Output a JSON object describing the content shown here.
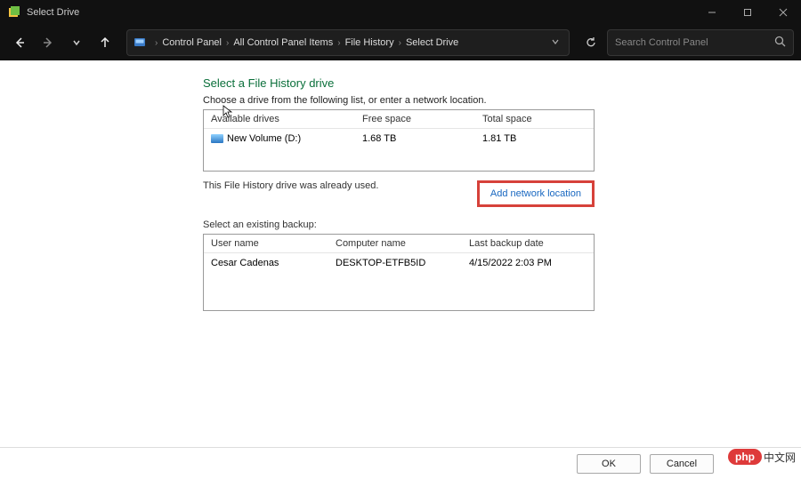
{
  "window": {
    "title": "Select Drive"
  },
  "breadcrumb": {
    "items": [
      "Control Panel",
      "All Control Panel Items",
      "File History",
      "Select Drive"
    ]
  },
  "search": {
    "placeholder": "Search Control Panel"
  },
  "page": {
    "title": "Select a File History drive",
    "description": "Choose a drive from the following list, or enter a network location."
  },
  "drives": {
    "headers": {
      "name": "Available drives",
      "free": "Free space",
      "total": "Total space"
    },
    "rows": [
      {
        "name": "New Volume (D:)",
        "free": "1.68 TB",
        "total": "1.81 TB"
      }
    ]
  },
  "status": {
    "already_used": "This File History drive was already used.",
    "add_network_link": "Add network location"
  },
  "backups": {
    "heading": "Select an existing backup:",
    "headers": {
      "user": "User name",
      "computer": "Computer name",
      "last": "Last backup date"
    },
    "rows": [
      {
        "user": "Cesar Cadenas",
        "computer": "DESKTOP-ETFB5ID",
        "last": "4/15/2022 2:03 PM"
      }
    ]
  },
  "buttons": {
    "ok": "OK",
    "cancel": "Cancel"
  },
  "watermark": {
    "pill": "php",
    "text": "中文网"
  }
}
